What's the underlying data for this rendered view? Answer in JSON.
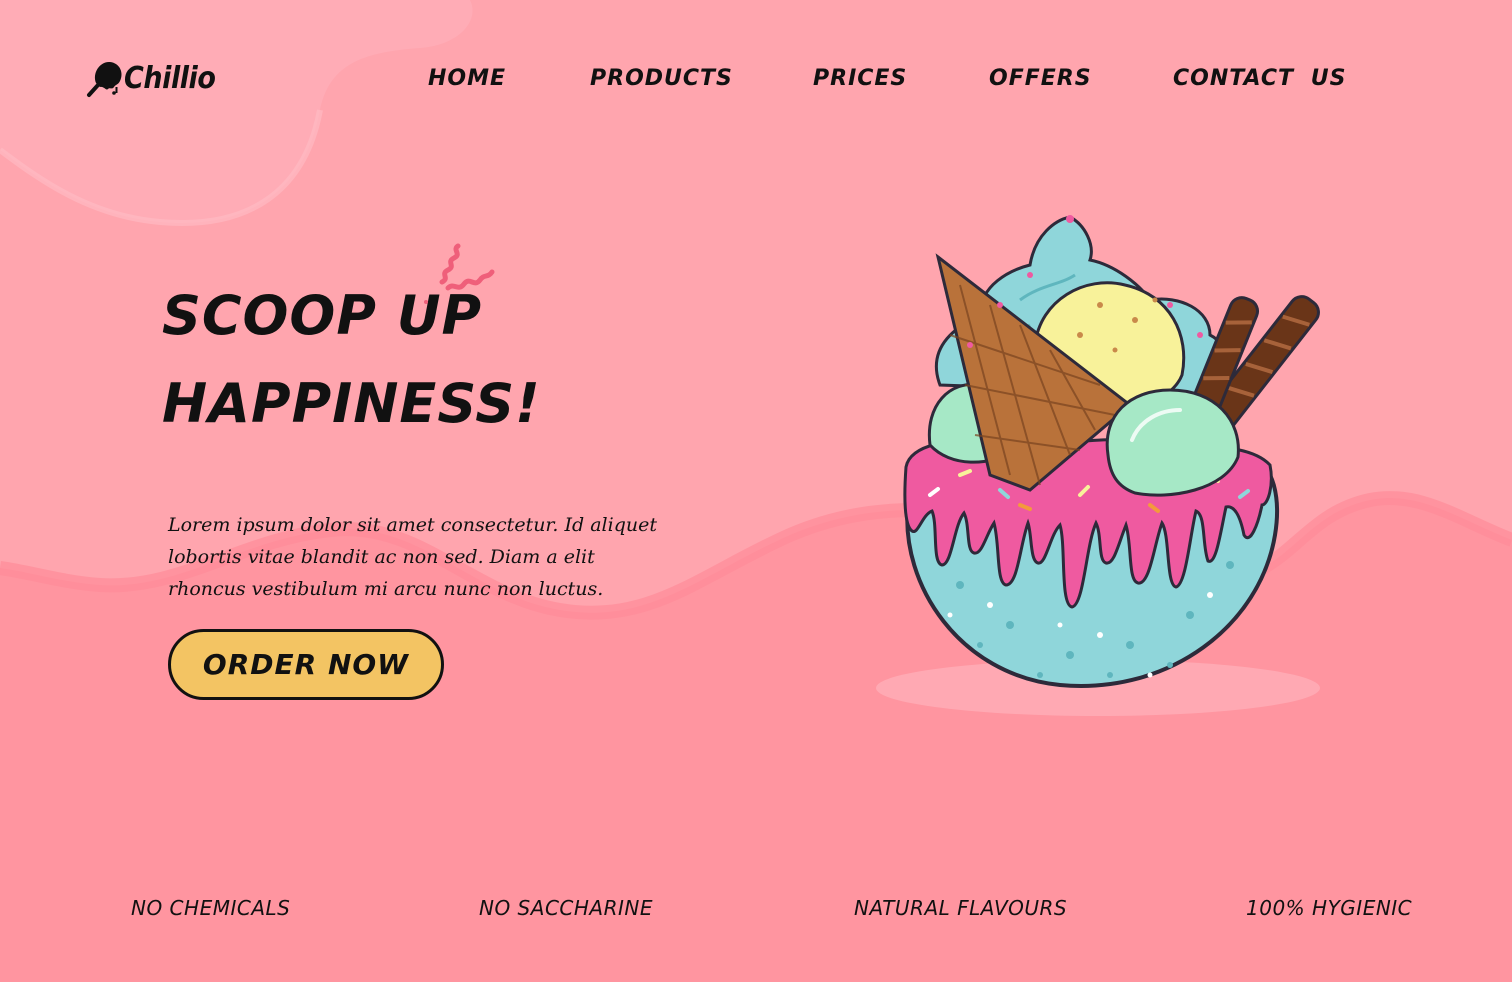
{
  "brand": {
    "name": "Chillio",
    "logo_icon": "ice-cream-scoop-icon"
  },
  "nav": {
    "items": [
      {
        "label": "HOME"
      },
      {
        "label": "PRODUCTS"
      },
      {
        "label": "PRICES"
      },
      {
        "label": "OFFERS"
      },
      {
        "label": "CONTACT US"
      }
    ]
  },
  "hero": {
    "title_line1": "SCOOP UP",
    "title_line2": "HAPPINESS!",
    "description": "Lorem ipsum dolor sit amet consectetur. Id aliquet lobortis vitae blandit ac non sed. Diam a elit rhoncus vestibulum mi arcu nunc non luctus.",
    "cta_label": "ORDER NOW"
  },
  "features": [
    {
      "label": "NO CHEMICALS"
    },
    {
      "label": "NO SACCHARINE"
    },
    {
      "label": "NATURAL FLAVOURS"
    },
    {
      "label": "100% HYGIENIC"
    }
  ],
  "colors": {
    "background_top": "#ffa5ae",
    "background_bottom": "#ff95a0",
    "button": "#f3c463",
    "accent_pink": "#ef5f7a",
    "scoop_blue": "#8fd6da",
    "scoop_green": "#a6e8c6",
    "scoop_yellow": "#f8f29a",
    "drizzle_pink": "#ef5aa0"
  }
}
